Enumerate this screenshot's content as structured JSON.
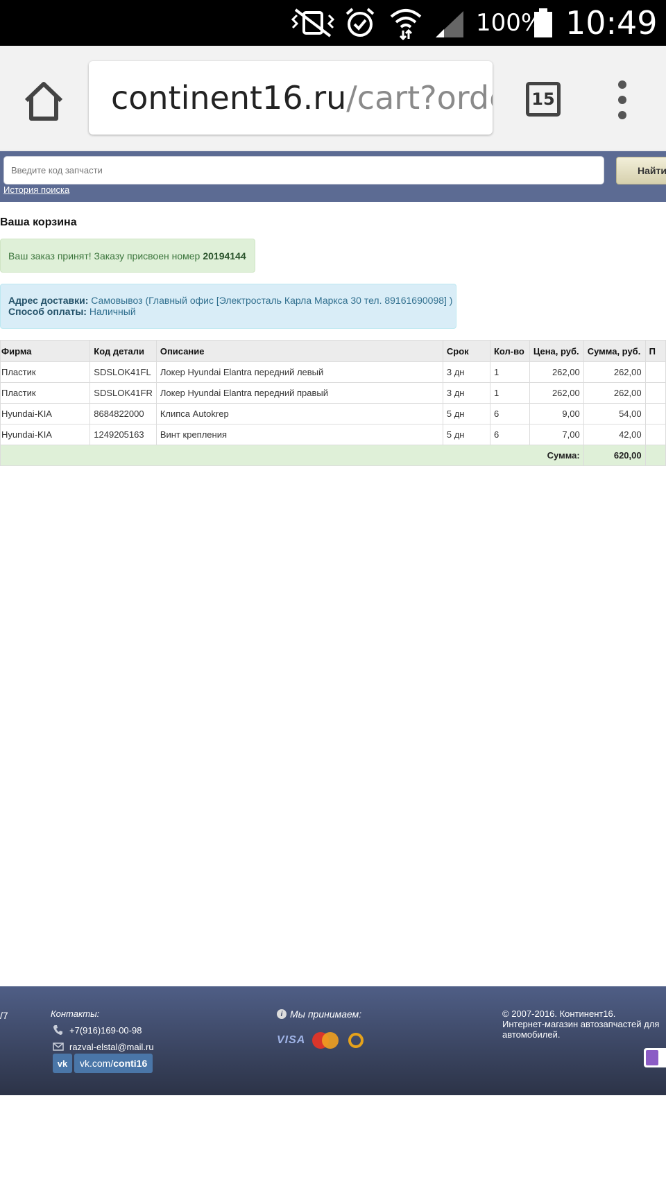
{
  "status_bar": {
    "battery_percent": "100%",
    "time": "10:49",
    "icons": [
      "mute-vibrate-icon",
      "alarm-icon",
      "wifi-icon",
      "signal-icon",
      "battery-icon"
    ]
  },
  "browser": {
    "url_domain": "continent16.ru",
    "url_path": "/cart?orderco",
    "tab_count": "15"
  },
  "search": {
    "placeholder": "Введите код запчасти",
    "button_label": "Найти",
    "history_link": "История поиска"
  },
  "cart": {
    "title": "Ваша корзина",
    "success_prefix": "Ваш заказ принят! Заказу присвоен номер",
    "order_number": "20194144",
    "delivery_label": "Адрес доставки:",
    "delivery_value": "Самовывоз (Главный офис [Электросталь Карла Маркса 30 тел. 89161690098] )",
    "payment_label": "Способ оплаты:",
    "payment_value": "Наличный"
  },
  "table": {
    "headers": [
      "Фирма",
      "Код детали",
      "Описание",
      "Срок",
      "Кол-во",
      "Цена, руб.",
      "Сумма, руб.",
      "П"
    ],
    "rows": [
      [
        "Пластик",
        "SDSLOK41FL",
        "Локер Hyundai Elantra передний левый",
        "3 дн",
        "1",
        "262,00",
        "262,00",
        ""
      ],
      [
        "Пластик",
        "SDSLOK41FR",
        "Локер Hyundai Elantra передний правый",
        "3 дн",
        "1",
        "262,00",
        "262,00",
        ""
      ],
      [
        "Hyundai-KIA",
        "8684822000",
        "Клипса Autokrep",
        "5 дн",
        "6",
        "9,00",
        "54,00",
        ""
      ],
      [
        "Hyundai-KIA",
        "1249205163",
        "Винт крепления",
        "5 дн",
        "6",
        "7,00",
        "42,00",
        ""
      ]
    ],
    "total_label": "Сумма:",
    "total_value": "620,00"
  },
  "footer": {
    "left_fragment": "/7",
    "contacts_label": "Контакты:",
    "phone": "+7(916)169-00-98",
    "email": "razval-elstal@mail.ru",
    "vk_logo": "vk",
    "vk_prefix": "vk.com/",
    "vk_handle": "conti16",
    "accept_label": "Мы принимаем:",
    "visa_label": "VISA",
    "copyright_line1": "© 2007-2016. Континент16.",
    "copyright_line2": "Интернет-магазин автозапчастей для автомобилей."
  },
  "colors": {
    "header_band": "#5c6b93",
    "success_bg": "#dff0d8",
    "info_bg": "#d9edf7",
    "footer_top": "#4f5e86",
    "footer_bottom": "#2c3347"
  }
}
